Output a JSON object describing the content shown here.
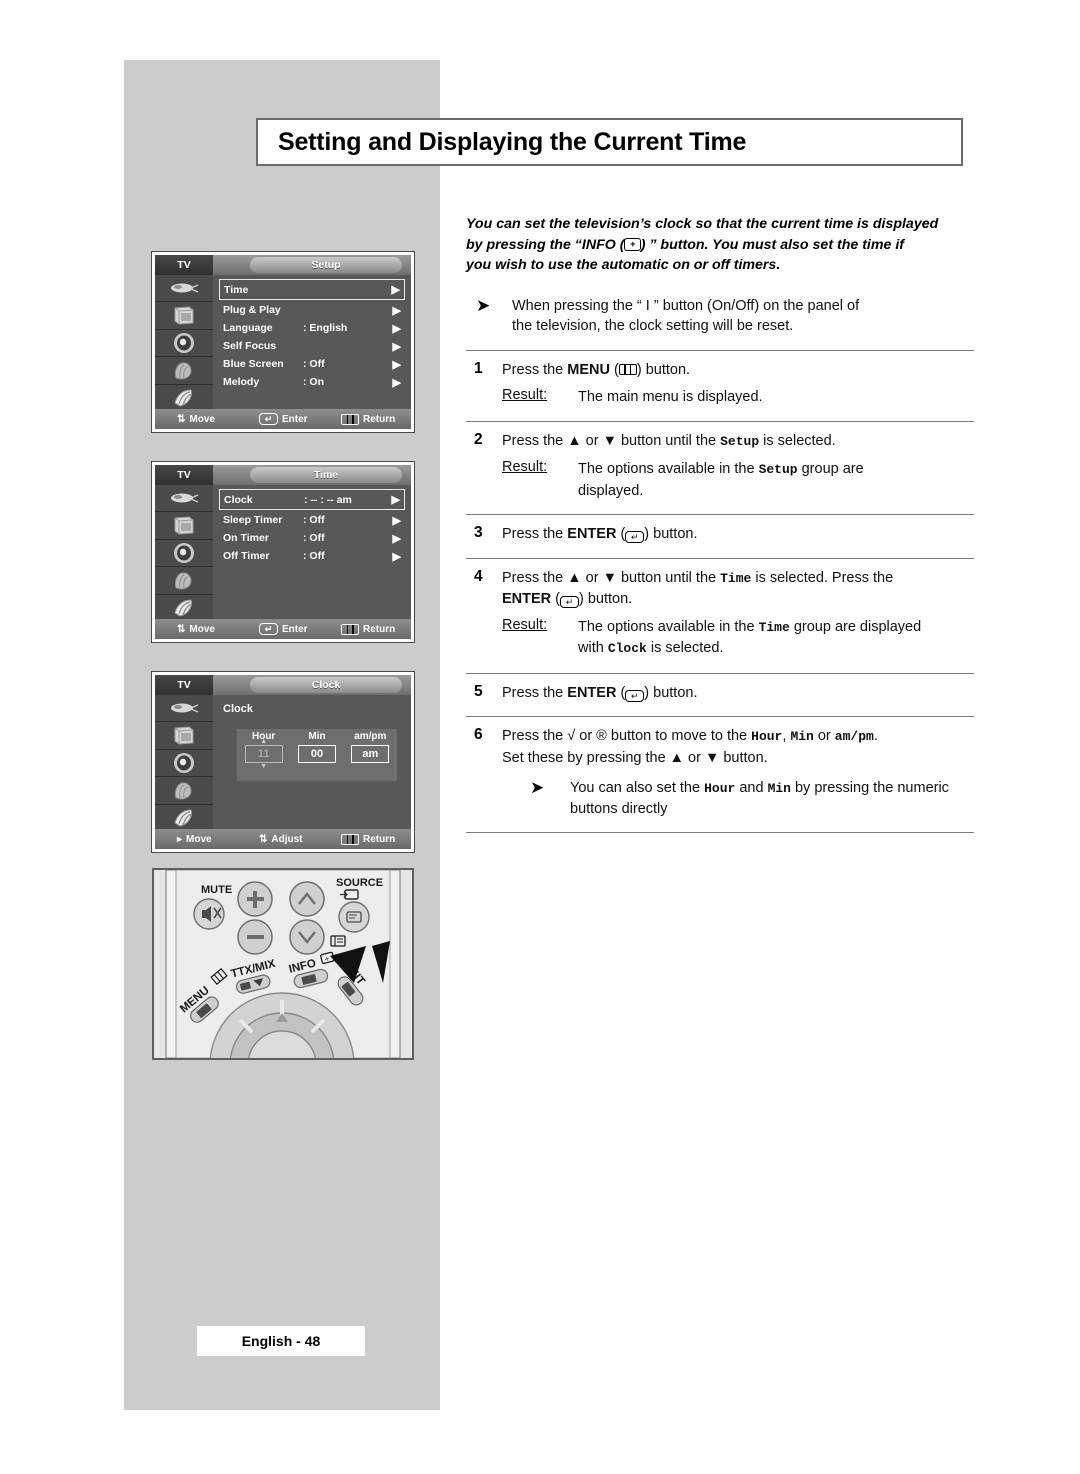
{
  "page": {
    "title": "Setting and Displaying the Current Time",
    "footer": "English - 48",
    "panel_color": "#cccccc"
  },
  "intro": {
    "line1": "You can set the television’s clock so that the current time is displayed",
    "line2_a": "by pressing the “INFO (",
    "line2_b": ") ” button. You must also set the time if",
    "line3": "you wish to use the automatic on or off timers.",
    "note_bullet": "➤",
    "note_line1": "When pressing the “ I ” button (On/Off) on the panel of",
    "note_line2": "the television, the clock setting will be reset."
  },
  "steps": [
    {
      "num": "1",
      "pre": "Press the ",
      "bold": "MENU",
      "mid": " (",
      "post": ") button.",
      "result_label": "Result:",
      "result": "The main menu is displayed."
    },
    {
      "num": "2",
      "pre": "Press the ▲ or ▼ button until the ",
      "code": "Setup",
      "post": " is selected.",
      "result_label": "Result:",
      "result_a": "The options available in the ",
      "result_code": "Setup",
      "result_b": " group are",
      "result_c": "displayed."
    },
    {
      "num": "3",
      "pre": "Press the ",
      "bold": "ENTER",
      "mid": " (",
      "post": ") button."
    },
    {
      "num": "4",
      "pre": "Press the ▲ or ▼ button until the ",
      "code": "Time",
      "post": " is selected. Press the",
      "line2_bold": "ENTER",
      "line2_mid": " (",
      "line2_post": ") button.",
      "result_label": "Result:",
      "result_a": "The options available in the ",
      "result_code": "Time",
      "result_b": " group are displayed",
      "result_c1": "with ",
      "result_code2": "Clock",
      "result_c2": " is selected."
    },
    {
      "num": "5",
      "pre": "Press the ",
      "bold": "ENTER",
      "mid": " (",
      "post": ") button."
    },
    {
      "num": "6",
      "pre": "Press the √ or ®  button to move to the ",
      "code1": "Hour",
      "sep1": ", ",
      "code2": "Min",
      "sep2": " or ",
      "code3": "am/pm",
      "post": ".",
      "line2": "Set these by pressing the ▲ or ▼ button.",
      "sub_bullet": "➤",
      "sub_a": "You can also set the ",
      "sub_code1": "Hour",
      "sub_b": " and ",
      "sub_code2": "Min",
      "sub_c": " by pressing the numeric",
      "sub_line2": "buttons directly"
    }
  ],
  "osd_setup": {
    "device": "TV",
    "tab": "Setup",
    "rows": [
      {
        "label": "Time",
        "value": "",
        "caret": "▶",
        "selected": true
      },
      {
        "label": "Plug & Play",
        "value": "",
        "caret": "▶",
        "selected": false
      },
      {
        "label": "Language",
        "value": ": English",
        "caret": "▶",
        "selected": false
      },
      {
        "label": "Self Focus",
        "value": "",
        "caret": "▶",
        "selected": false
      },
      {
        "label": "Blue Screen",
        "value": ": Off",
        "caret": "▶",
        "selected": false
      },
      {
        "label": "Melody",
        "value": ": On",
        "caret": "▶",
        "selected": false
      }
    ],
    "foot": {
      "a": "Move",
      "b": "Enter",
      "c": "Return"
    }
  },
  "osd_time": {
    "device": "TV",
    "tab": "Time",
    "rows": [
      {
        "label": "Clock",
        "value": ": -- : --  am",
        "caret": "▶",
        "selected": true
      },
      {
        "label": "Sleep Timer",
        "value": ": Off",
        "caret": "▶",
        "selected": false
      },
      {
        "label": "On Timer",
        "value": ": Off",
        "caret": "▶",
        "selected": false
      },
      {
        "label": "Off Timer",
        "value": ": Off",
        "caret": "▶",
        "selected": false
      }
    ],
    "foot": {
      "a": "Move",
      "b": "Enter",
      "c": "Return"
    }
  },
  "osd_clock": {
    "device": "TV",
    "tab": "Clock",
    "label": "Clock",
    "headings": {
      "hour": "Hour",
      "min": "Min",
      "ampm": "am/pm"
    },
    "values": {
      "hour": "11",
      "min": "00",
      "ampm": "am"
    },
    "foot": {
      "a": "Move",
      "b": "Adjust",
      "c": "Return"
    }
  },
  "remote": {
    "mute": "MUTE",
    "source": "SOURCE",
    "ttx": "TTX/MIX",
    "menu": "MENU",
    "info": "INFO",
    "exit": "EXIT"
  }
}
